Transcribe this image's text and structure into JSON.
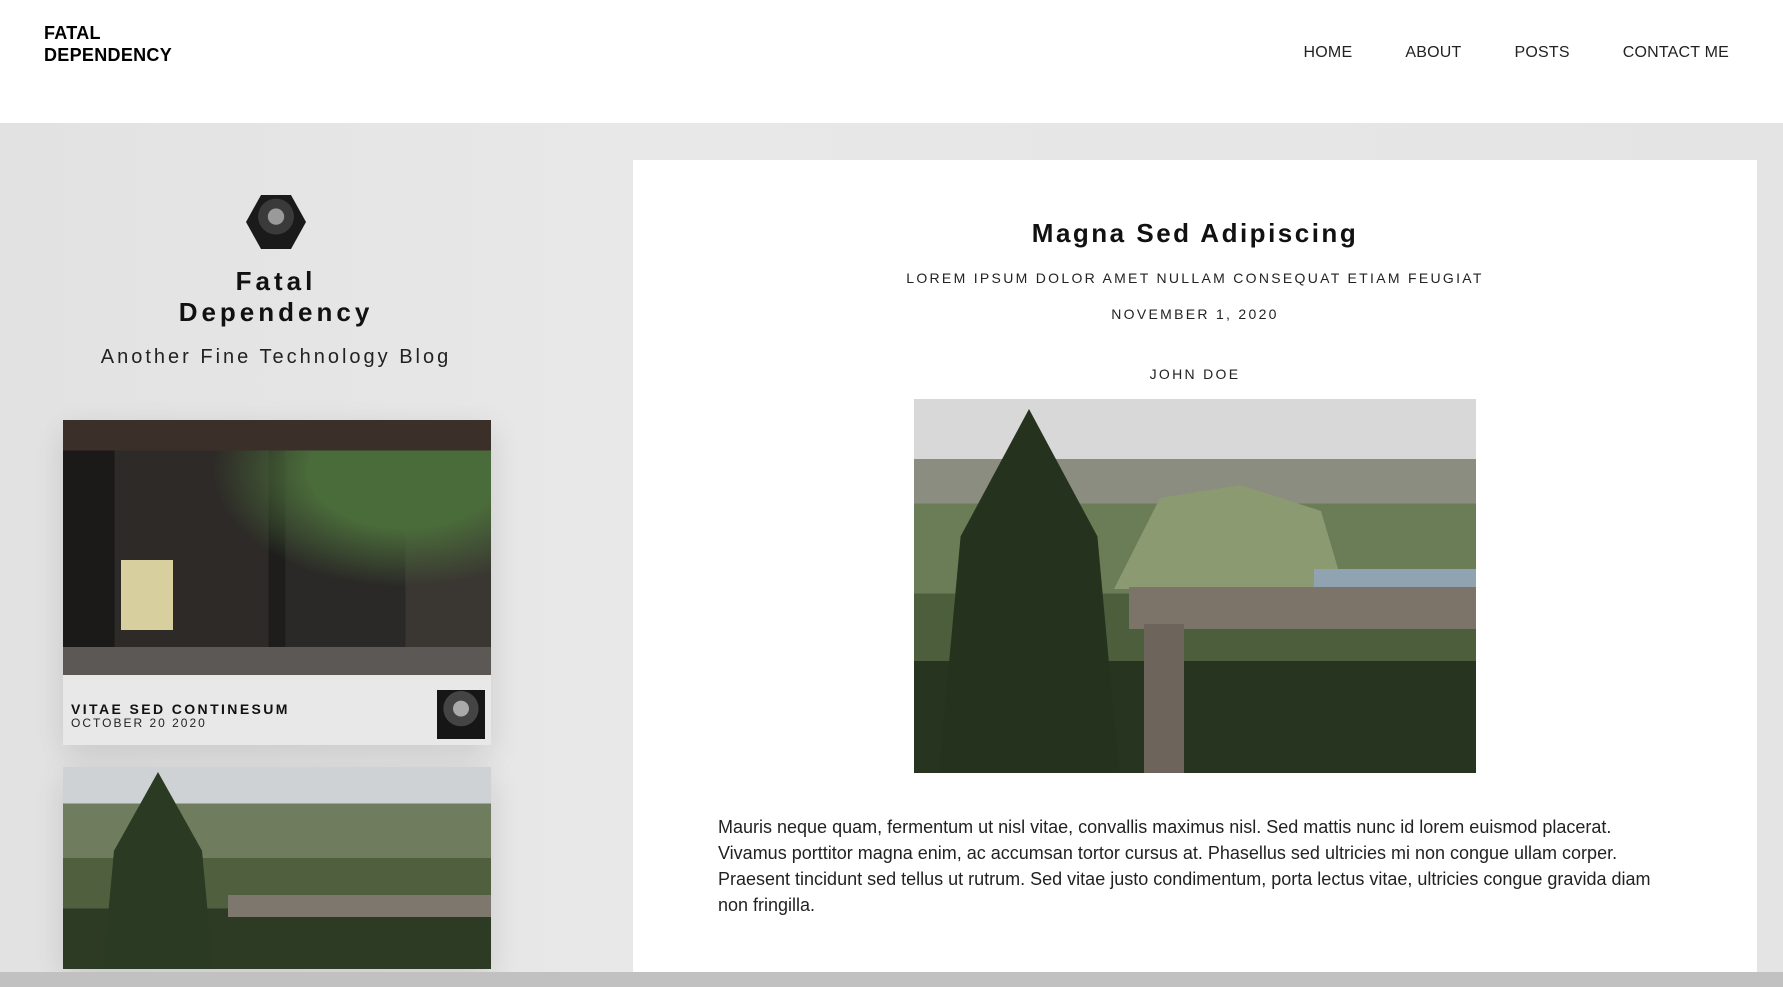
{
  "header": {
    "logo_line1": "FATAL",
    "logo_line2": "DEPENDENCY",
    "nav": [
      "HOME",
      "ABOUT",
      "POSTS",
      "CONTACT ME"
    ]
  },
  "sidebar": {
    "title_line1": "Fatal",
    "title_line2": "Dependency",
    "subtitle": "Another Fine Technology Blog",
    "cards": [
      {
        "title": "VITAE SED CONTINESUM",
        "date": "OCTOBER 20 2020"
      }
    ]
  },
  "article": {
    "title": "Magna Sed Adipiscing",
    "subtitle": "LOREM IPSUM DOLOR AMET NULLAM CONSEQUAT ETIAM FEUGIAT",
    "date": "NOVEMBER 1, 2020",
    "author": "JOHN DOE",
    "body": "Mauris neque quam, fermentum ut nisl vitae, convallis maximus nisl. Sed mattis nunc id lorem euismod placerat. Vivamus porttitor magna enim, ac accumsan tortor cursus at. Phasellus sed ultricies mi non congue ullam corper. Praesent tincidunt sed tellus ut rutrum. Sed vitae justo condimentum, porta lectus vitae, ultricies congue gravida diam non fringilla."
  }
}
